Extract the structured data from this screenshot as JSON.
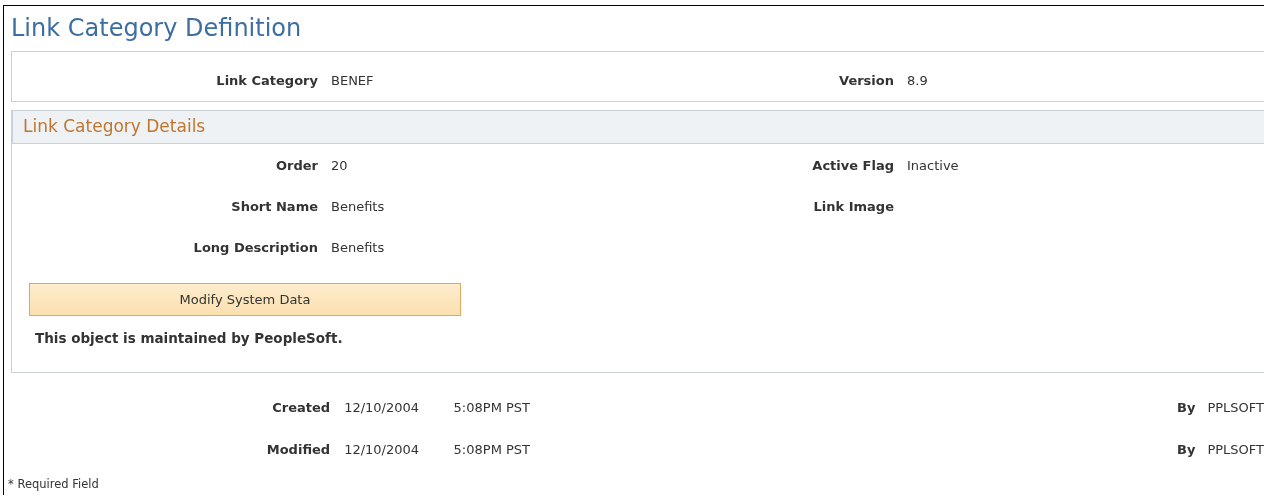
{
  "page_title": "Link Category Definition",
  "header": {
    "fields": [
      {
        "label": "Link Category",
        "value": "BENEF"
      },
      {
        "label": "Version",
        "value": "8.9"
      }
    ]
  },
  "details": {
    "title": "Link Category Details",
    "rows": [
      [
        {
          "label": "Order",
          "value": "20"
        },
        {
          "label": "Active Flag",
          "value": "Inactive"
        }
      ],
      [
        {
          "label": "Short Name",
          "value": "Benefits"
        },
        {
          "label": "Link Image"
        }
      ],
      [
        {
          "label": "Long Description",
          "value": "Benefits"
        }
      ]
    ],
    "button": {
      "label": "Modify System Data"
    },
    "note": "This object is maintained by PeopleSoft."
  },
  "audit": [
    {
      "label": "Created",
      "date": "12/10/2004",
      "time": "5:08PM PST",
      "by_label": "By",
      "by": "PPLSOFT"
    },
    {
      "label": "Modified",
      "date": "12/10/2004",
      "time": "5:08PM PST",
      "by_label": "By",
      "by": "PPLSOFT"
    }
  ],
  "footnote": "* Required Field"
}
